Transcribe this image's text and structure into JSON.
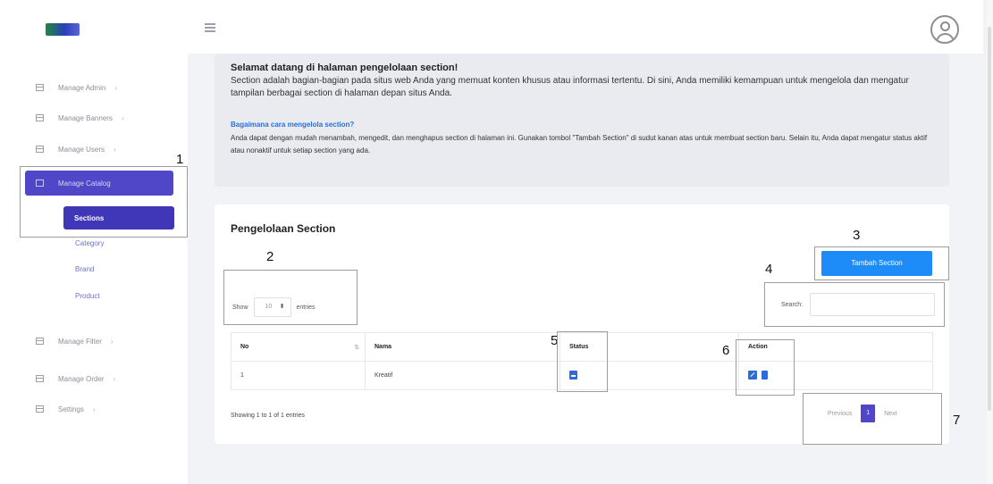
{
  "sidebar": {
    "items_top": [
      {
        "label": "Manage Admin"
      },
      {
        "label": "Manage Banners"
      },
      {
        "label": "Manage Users"
      }
    ],
    "active_label": "Manage Catalog",
    "sub_active": "Sections",
    "sub_items": [
      "Category",
      "Brand",
      "Product"
    ],
    "items_bottom": [
      {
        "label": "Manage Filter"
      },
      {
        "label": "Manage Order"
      },
      {
        "label": "Settings"
      }
    ],
    "chevron": "›"
  },
  "info": {
    "title": "Selamat datang di halaman pengelolaan section!",
    "text": "Section adalah bagian-bagian pada situs web Anda yang memuat konten khusus atau informasi tertentu. Di sini, Anda memiliki kemampuan untuk mengelola dan mengatur tampilan berbagai section di halaman depan situs Anda.",
    "subtitle": "Bagaimana cara mengelola section?",
    "text2": "Anda dapat dengan mudah menambah, mengedit, dan menghapus section di halaman ini. Gunakan tombol \"Tambah Section\" di sudut kanan atas untuk membuat section baru. Selain itu, Anda dapat mengatur status aktif atau nonaktif untuk setiap section yang ada."
  },
  "card": {
    "title": "Pengelolaan Section",
    "add_button": "Tambah Section",
    "show_label": "Show",
    "show_value": "10",
    "entries_label": "entries",
    "search_label": "Search:",
    "columns": [
      "No",
      "Nama",
      "Status",
      "Action"
    ],
    "rows": [
      {
        "no": "1",
        "nama": "Kreatif"
      }
    ],
    "footer": "Showing 1 to 1 of 1 entries",
    "pager": {
      "prev": "Previous",
      "page": "1",
      "next": "Next"
    }
  },
  "annotations": [
    "1",
    "2",
    "3",
    "4",
    "5",
    "6",
    "7"
  ],
  "colors": {
    "primary": "#4f46c8",
    "button": "#1d8cf8",
    "icon": "#2f6ad9"
  }
}
